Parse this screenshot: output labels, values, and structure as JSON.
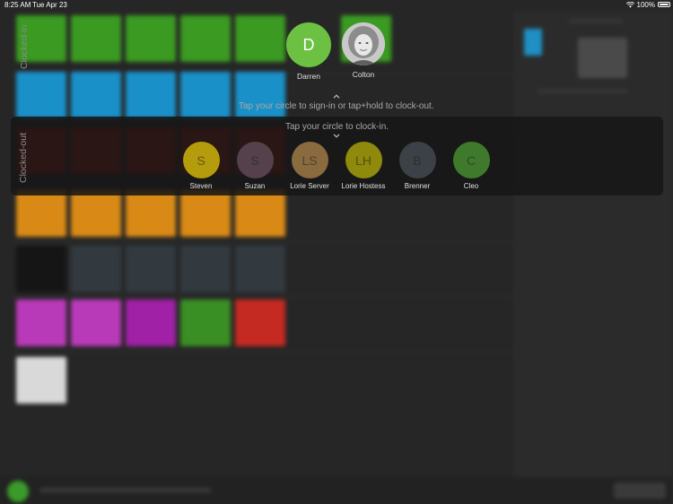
{
  "status_bar": {
    "time": "8:25 AM",
    "date": "Tue Apr 23",
    "battery": "100%"
  },
  "clocked_in": {
    "label": "Clocked-in",
    "hint": "Tap your circle to sign-in or tap+hold to clock-out.",
    "staff": [
      {
        "initials": "D",
        "name": "Darren",
        "color": "#6cc142"
      },
      {
        "initials": "",
        "name": "Colton",
        "photo": true
      }
    ]
  },
  "clocked_out": {
    "label": "Clocked-out",
    "hint": "Tap your circle to clock-in.",
    "staff": [
      {
        "initials": "S",
        "name": "Steven",
        "color": "#b59c0c"
      },
      {
        "initials": "S",
        "name": "Suzan",
        "color": "#54414c"
      },
      {
        "initials": "LS",
        "name": "Lorie Server",
        "color": "#8a6a3f"
      },
      {
        "initials": "LH",
        "name": "Lorie Hostess",
        "color": "#8f8a0b"
      },
      {
        "initials": "B",
        "name": "Brenner",
        "color": "#3c4148"
      },
      {
        "initials": "C",
        "name": "Cleo",
        "color": "#3f7a2c"
      }
    ]
  },
  "colors": {
    "background": "#262626",
    "tile_green": "#3b9a22",
    "tile_blue": "#1a90c8",
    "tile_red": "#a0150f",
    "tile_orange": "#d98a16",
    "tile_magenta": "#b93ab9"
  }
}
